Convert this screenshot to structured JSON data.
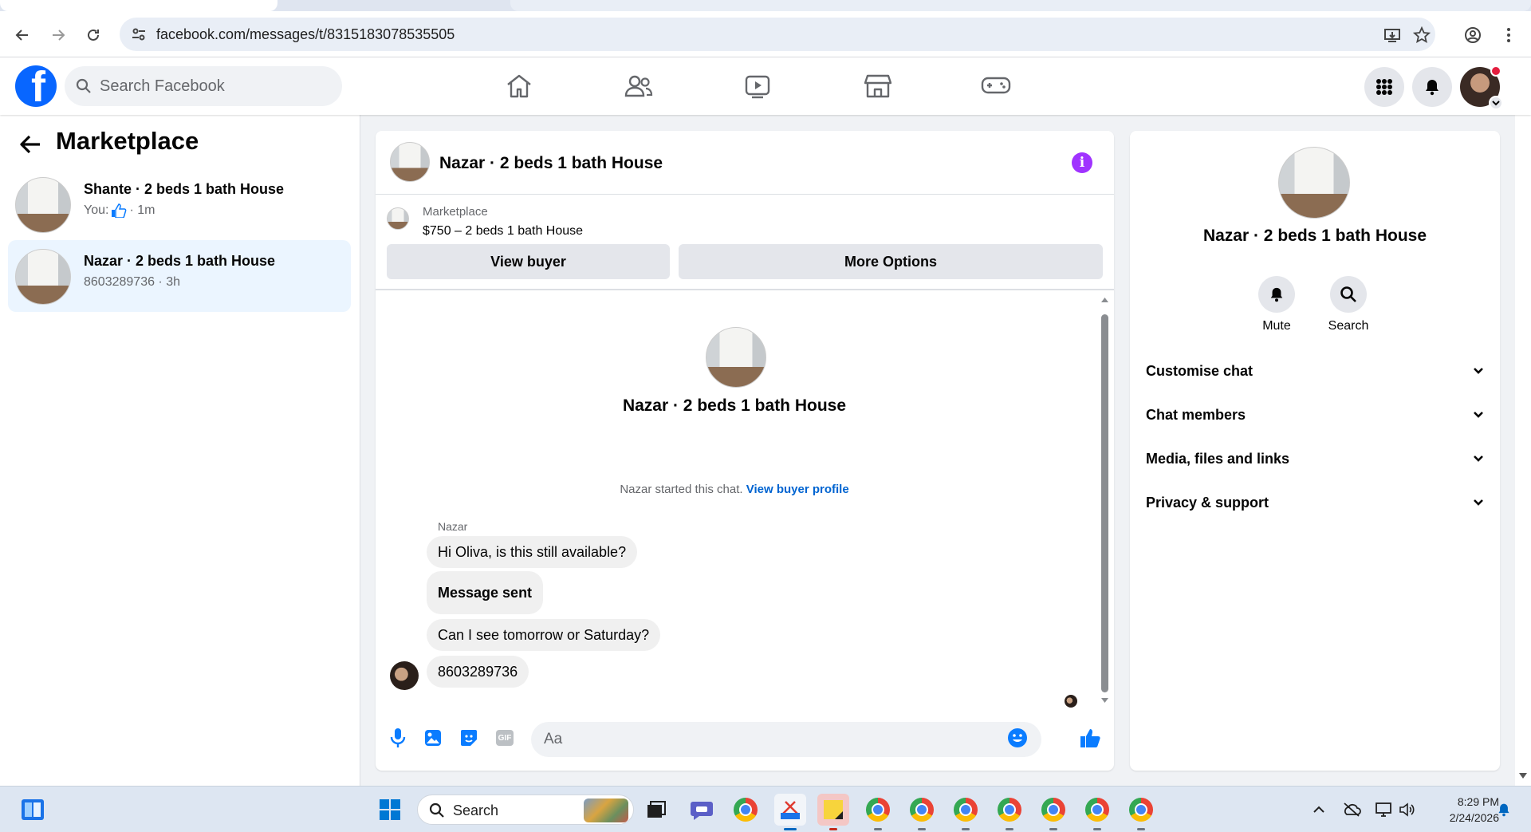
{
  "browser": {
    "url": "facebook.com/messages/t/8315183078535505"
  },
  "fb": {
    "logo_letter": "f",
    "search_placeholder": "Search Facebook"
  },
  "sidebar": {
    "title": "Marketplace",
    "conversations": [
      {
        "name": "Shante · 2 beds 1 bath House",
        "sub_prefix": "You:",
        "sub_time": "· 1m"
      },
      {
        "name": "Nazar · 2 beds 1 bath House",
        "sub": "8603289736 · 3h"
      }
    ]
  },
  "chat": {
    "title": "Nazar · 2 beds 1 bath House",
    "info_glyph": "i",
    "listing": {
      "category": "Marketplace",
      "price_title": "$750 – 2 beds 1 bath House",
      "view_buyer": "View buyer",
      "more_options": "More Options"
    },
    "thread": {
      "name": "Nazar · 2 beds 1 bath House",
      "started_text": "Nazar started this chat.",
      "started_link": "View buyer profile",
      "sender": "Nazar",
      "messages": [
        "Hi Oliva, is this still available?",
        "Message sent",
        "Can I see tomorrow or Saturday?",
        "8603289736"
      ]
    },
    "composer": {
      "placeholder": "Aa",
      "gif_label": "GIF"
    }
  },
  "details": {
    "name": "Nazar · 2 beds 1 bath House",
    "actions": {
      "mute": "Mute",
      "search": "Search"
    },
    "sections": [
      "Customise chat",
      "Chat members",
      "Media, files and links",
      "Privacy & support"
    ]
  },
  "taskbar": {
    "search_label": "Search",
    "time": "8:29 PM",
    "date": "2/24/2026"
  },
  "colors": {
    "fb_blue": "#0866ff",
    "messenger_accent": "#0a7cff",
    "info_purple": "#a033ff",
    "active_conversation": "#ebf5ff"
  }
}
